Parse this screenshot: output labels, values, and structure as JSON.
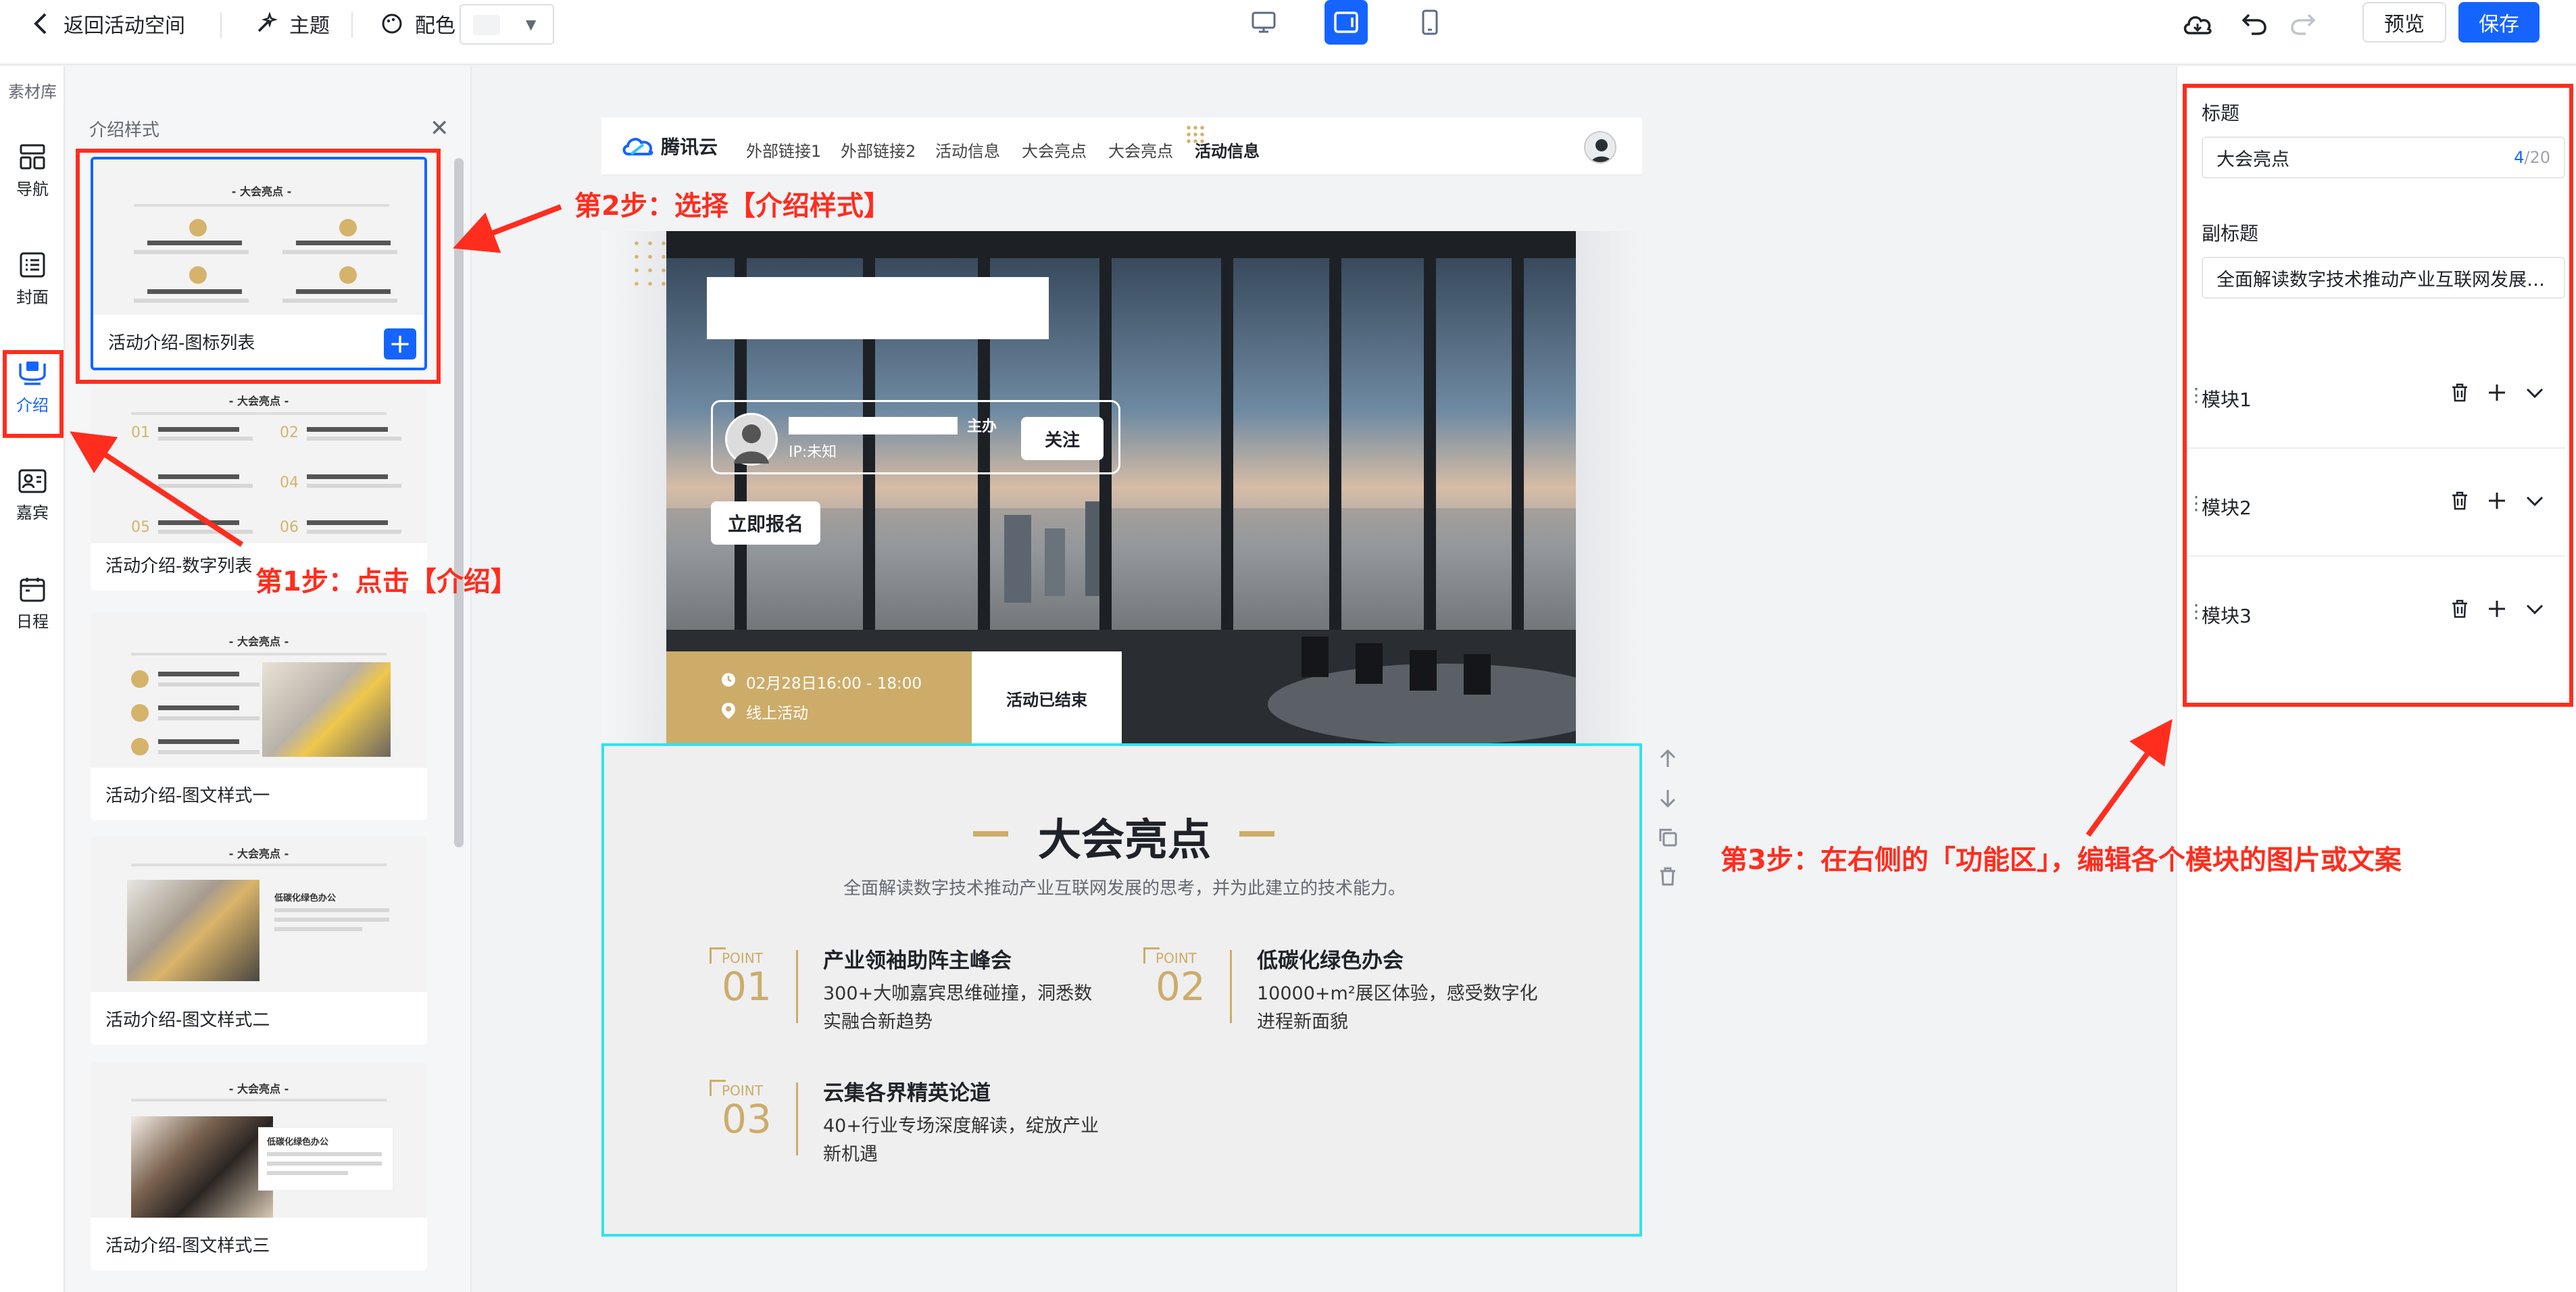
{
  "topbar": {
    "back_label": "返回活动空间",
    "theme_label": "主题",
    "palette_label": "配色",
    "preview_label": "预览",
    "save_label": "保存"
  },
  "sidebar": {
    "library_label": "素材库",
    "items": [
      {
        "label": "导航",
        "icon": "nav-grid-icon"
      },
      {
        "label": "封面",
        "icon": "cover-list-icon"
      },
      {
        "label": "介绍",
        "icon": "intro-icon"
      },
      {
        "label": "嘉宾",
        "icon": "guest-card-icon"
      },
      {
        "label": "日程",
        "icon": "schedule-icon"
      }
    ]
  },
  "style_panel": {
    "title": "介绍样式",
    "cards": [
      {
        "label": "活动介绍-图标列表",
        "mini_title": "- 大会亮点 -"
      },
      {
        "label": "活动介绍-数字列表",
        "mini_title": "- 大会亮点 -",
        "mini_nums": [
          "01",
          "02",
          "04",
          "05",
          "06"
        ]
      },
      {
        "label": "活动介绍-图文样式一",
        "mini_title": "- 大会亮点 -"
      },
      {
        "label": "活动介绍-图文样式二",
        "mini_title": "- 大会亮点 -",
        "mini_item": "低碳化绿色办公"
      },
      {
        "label": "活动介绍-图文样式三",
        "mini_title": "- 大会亮点 -",
        "mini_item": "低碳化绿色办公"
      }
    ]
  },
  "page": {
    "logo": "腾讯云",
    "nav_links": [
      "外部链接1",
      "外部链接2",
      "活动信息",
      "大会亮点",
      "大会亮点",
      "活动信息"
    ],
    "host_role": "主办",
    "host_ip": "IP:未知",
    "follow_label": "关注",
    "register_label": "立即报名",
    "time": "02月28日16:00 - 18:00",
    "location": "线上活动",
    "status": "活动已结束",
    "section_title": "大会亮点",
    "section_subtitle": "全面解读数字技术推动产业互联网发展的思考，并为此建立的技术能力。",
    "point_word": "POINT",
    "points": [
      {
        "num": "01",
        "title": "产业领袖助阵主峰会",
        "desc": "300+大咖嘉宾思维碰撞，洞悉数实融合新趋势"
      },
      {
        "num": "02",
        "title": "低碳化绿色办会",
        "desc": "10000+m²展区体验，感受数字化进程新面貌"
      },
      {
        "num": "03",
        "title": "云集各界精英论道",
        "desc": "40+行业专场深度解读，绽放产业新机遇"
      }
    ]
  },
  "right_panel": {
    "title_label": "标题",
    "title_value": "大会亮点",
    "title_count": "4",
    "title_max": "/20",
    "subtitle_label": "副标题",
    "subtitle_value": "全面解读数字技术推动产业互联网发展…",
    "modules": [
      "模块1",
      "模块2",
      "模块3"
    ]
  },
  "annotations": {
    "step1": "第1步：点击【介绍】",
    "step2": "第2步：选择【介绍样式】",
    "step3": "第3步：在右侧的「功能区」，编辑各个模块的图片或文案"
  },
  "colors": {
    "accent": "#1664ff",
    "gold": "#cdac6a",
    "annotation_red": "#ff2d1e",
    "selection_cyan": "#2ee3f0"
  }
}
